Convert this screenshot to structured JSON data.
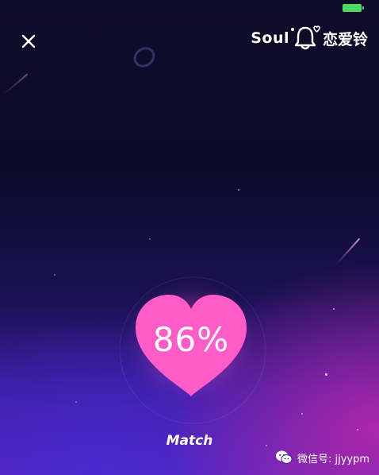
{
  "brand": {
    "word": "Soul",
    "chinese": "恋爱铃"
  },
  "match": {
    "percent_text": "86%",
    "label": "Match"
  },
  "watermark": {
    "text": "微信号: jjyypm"
  },
  "colors": {
    "heart": "#ff5cc8",
    "battery": "#4cd964",
    "accent_magenta": "#be28aa",
    "accent_blue": "#4628d2"
  },
  "icons": {
    "close": "close-icon",
    "bell": "bell-icon",
    "wechat": "wechat-icon"
  }
}
